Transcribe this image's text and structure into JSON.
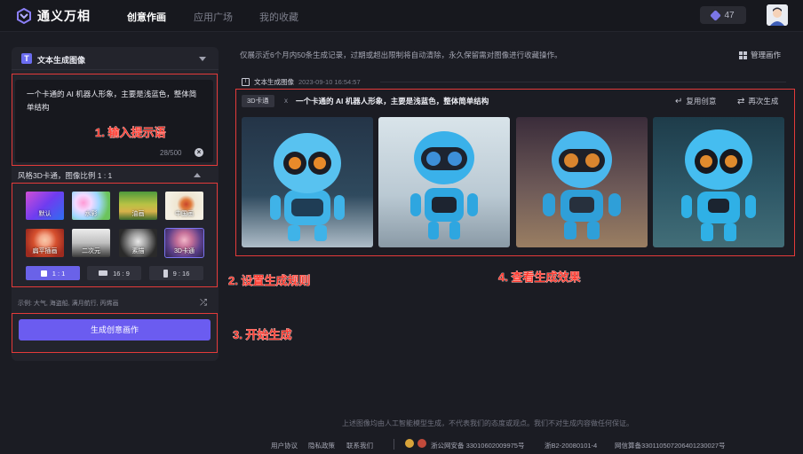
{
  "app": {
    "name": "通义万相"
  },
  "nav": {
    "items": [
      "创意作画",
      "应用广场",
      "我的收藏"
    ],
    "active": "创意作画"
  },
  "user": {
    "credits": "47",
    "avatar_icon": "user-avatar"
  },
  "panel": {
    "title": "文本生成图像",
    "prompt_text": "一个卡通的 AI 机器人形象，主要是浅蓝色，整体简单结构",
    "char_count": "28/500",
    "settings_summary": "风格3D卡通，图像比例 1 : 1",
    "styles": [
      "默认",
      "水彩",
      "油画",
      "中国画",
      "扁平插画",
      "二次元",
      "素描",
      "3D卡通"
    ],
    "selected_style": "3D卡通",
    "ratios": [
      "1 : 1",
      "16 : 9",
      "9 : 16"
    ],
    "selected_ratio": "1 : 1",
    "examples": "示例:  大气, 海盗船, 满月航行, 丙烯画",
    "generate_label": "生成创意画作"
  },
  "annotations": {
    "step1": "1. 输入提示语",
    "step2": "2. 设置生成规则",
    "step3": "3. 开始生成",
    "step4": "4. 查看生成效果"
  },
  "main": {
    "notice": "仅展示近6个月内50条生成记录，过期或超出限制将自动清除，永久保留需对图像进行收藏操作。",
    "manage_label": "管理画作",
    "record": {
      "type": "文本生成图像",
      "date": "2023-09-10 16:54:57",
      "style_tag": "3D卡通",
      "close_mark": "x",
      "prompt": "一个卡通的 AI 机器人形象，主要是浅蓝色，整体简单结构",
      "reuse_label": "复用创意",
      "regenerate_label": "再次生成"
    }
  },
  "footer": {
    "disclaimer": "上述图像均由人工智能模型生成，不代表我们的态度或观点。我们不对生成内容做任何保证。",
    "links": [
      "用户协议",
      "隐私政策",
      "联系我们"
    ],
    "police_record": "浙公网安备 33010602009975号",
    "icp": "浙B2-20080101-4",
    "net_record": "网信算备330110507206401230027号"
  },
  "colors": {
    "accent": "#6b5cf0",
    "annotation_red": "#e43a3a",
    "background": "#1b1c23"
  }
}
